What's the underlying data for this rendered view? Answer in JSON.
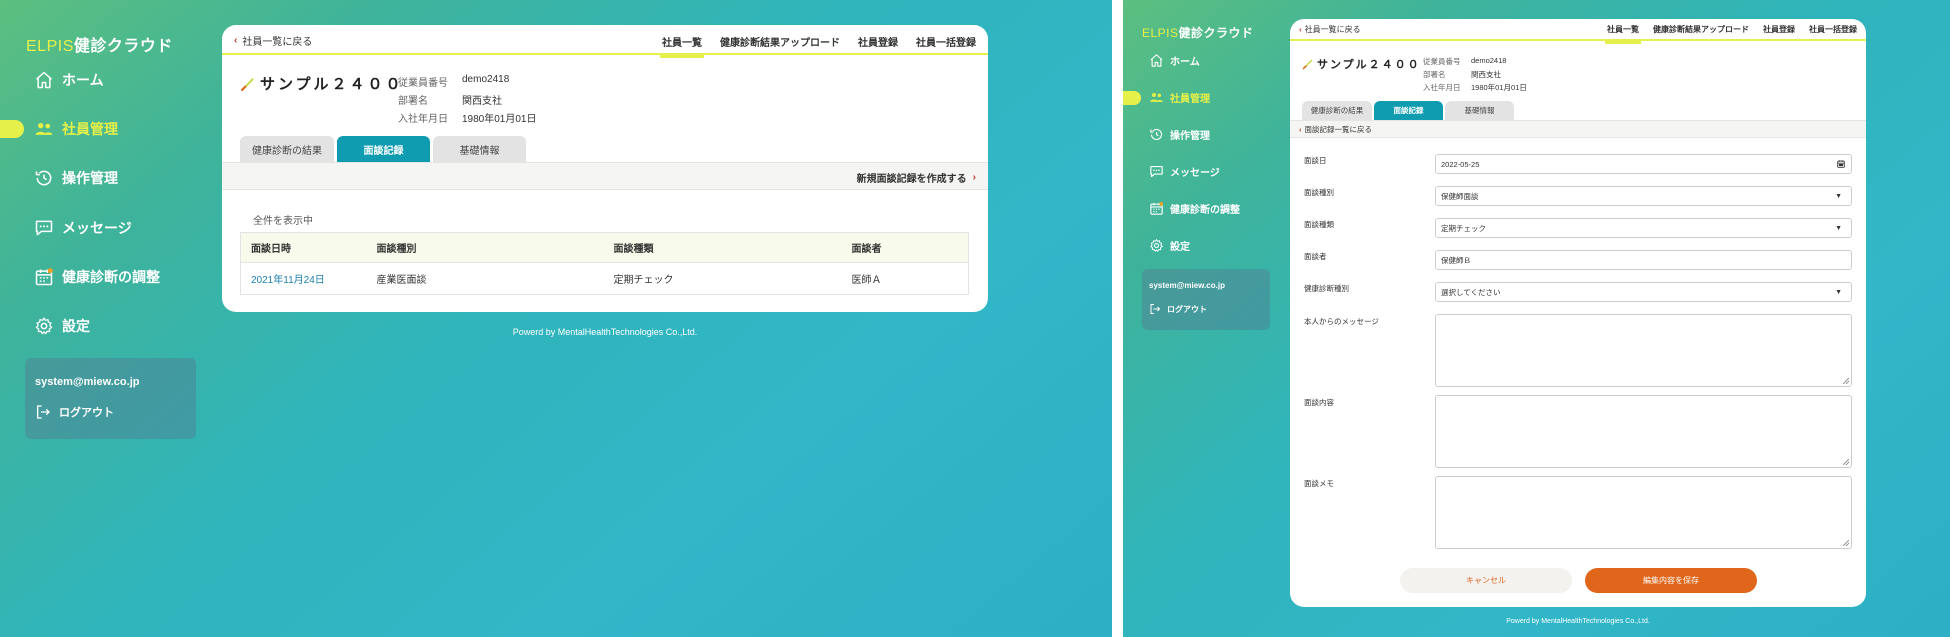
{
  "colors": {
    "accent_yellow": "#e6f04a",
    "teal_tab": "#0f9bb0",
    "save_orange": "#e0661b",
    "link_blue": "#1c7fae",
    "chevron_red": "#c0392b"
  },
  "app": {
    "logo_brand": "ELPIS",
    "logo_rest": "健診クラウド"
  },
  "sidebar": {
    "items": [
      {
        "label": "ホーム",
        "icon": "home-icon"
      },
      {
        "label": "社員管理",
        "icon": "users-icon",
        "active": true
      },
      {
        "label": "操作管理",
        "icon": "history-icon"
      },
      {
        "label": "メッセージ",
        "icon": "message-icon"
      },
      {
        "label": "健康診断の調整",
        "icon": "calendar-icon"
      },
      {
        "label": "設定",
        "icon": "gear-icon"
      }
    ],
    "user_email": "system@miew.co.jp",
    "logout_label": "ログアウト"
  },
  "topbar": {
    "back_label": "社員一覧に戻る",
    "nav": [
      "社員一覧",
      "健康診断結果アップロード",
      "社員登録",
      "社員一括登録"
    ],
    "active_nav": "社員一覧"
  },
  "employee": {
    "name": "サンプル２４００",
    "id_label": "従業員番号",
    "id_value": "demo2418",
    "dept_label": "部署名",
    "dept_value": "関西支社",
    "join_label": "入社年月日",
    "join_value": "1980年01月01日"
  },
  "tabs": [
    "健康診断の結果",
    "面談記録",
    "基礎情報"
  ],
  "active_tab": "面談記録",
  "records": {
    "new_record_label": "新規面談記録を作成する",
    "showing_label": "全件を表示中",
    "headers": [
      "面談日時",
      "面談種別",
      "面談種類",
      "面談者"
    ],
    "rows": [
      [
        "2021年11月24日",
        "産業医面談",
        "定期チェック",
        "医師Ａ"
      ]
    ]
  },
  "footer": "Powerd by MentalHealthTechnologies Co.,Ltd.",
  "form": {
    "back_label": "面談記録一覧に戻る",
    "fields": [
      {
        "label": "面談日",
        "value": "2022-05-25",
        "kind": "date"
      },
      {
        "label": "面談種別",
        "value": "保健師面談",
        "kind": "select"
      },
      {
        "label": "面談種類",
        "value": "定期チェック",
        "kind": "select"
      },
      {
        "label": "面談者",
        "value": "保健師Ｂ",
        "kind": "text"
      },
      {
        "label": "健康診断種別",
        "value": "選択してください",
        "kind": "select"
      }
    ],
    "textareas": [
      {
        "label": "本人からのメッセージ"
      },
      {
        "label": "面談内容"
      },
      {
        "label": "面談メモ"
      }
    ],
    "cancel_label": "キャンセル",
    "save_label": "編集内容を保存"
  }
}
